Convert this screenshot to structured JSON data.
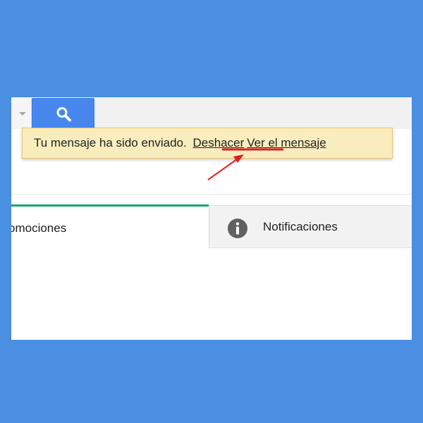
{
  "toast": {
    "message": "Tu mensaje ha sido enviado.",
    "undo_link": "Deshacer",
    "view_link": "Ver el mensaje"
  },
  "tabs": [
    {
      "label": "omociones",
      "active": true
    },
    {
      "label": "Notificaciones",
      "active": false,
      "icon": "info-icon"
    }
  ],
  "icons": {
    "search": "search-icon",
    "dropdown": "chevron-down-icon",
    "info": "info-icon"
  },
  "colors": {
    "background": "#4a8fe2",
    "search_button": "#4787ed",
    "toast_background": "#f9edbe",
    "toast_border": "#f0c36d",
    "active_tab_indicator": "#16a765",
    "annotation": "#e02020"
  }
}
